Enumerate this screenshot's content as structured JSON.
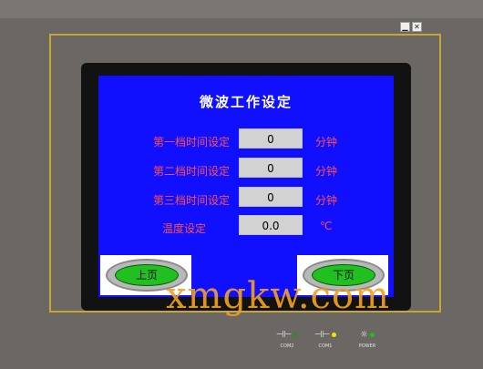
{
  "window": {
    "min_glyph": "▁",
    "close_glyph": "✕"
  },
  "screen": {
    "title": "微波工作设定",
    "rows": [
      {
        "label": "第一档时间设定",
        "value": "0",
        "unit": "分钟"
      },
      {
        "label": "第二档时间设定",
        "value": "0",
        "unit": "分钟"
      },
      {
        "label": "第三档时间设定",
        "value": "0",
        "unit": "分钟"
      },
      {
        "label": "温度设定",
        "value": "0.0",
        "unit": "℃"
      }
    ],
    "prev_label": "上页",
    "next_label": "下页"
  },
  "indicators": [
    {
      "label": "COM2",
      "glyph": "⊣⊢",
      "color": "#2d8a2d"
    },
    {
      "label": "COM1",
      "glyph": "⊣⊢",
      "color": "#f2e600"
    },
    {
      "label": "POWER",
      "glyph": "☼",
      "color": "#20c020"
    }
  ],
  "watermark": "xmgkw.com"
}
